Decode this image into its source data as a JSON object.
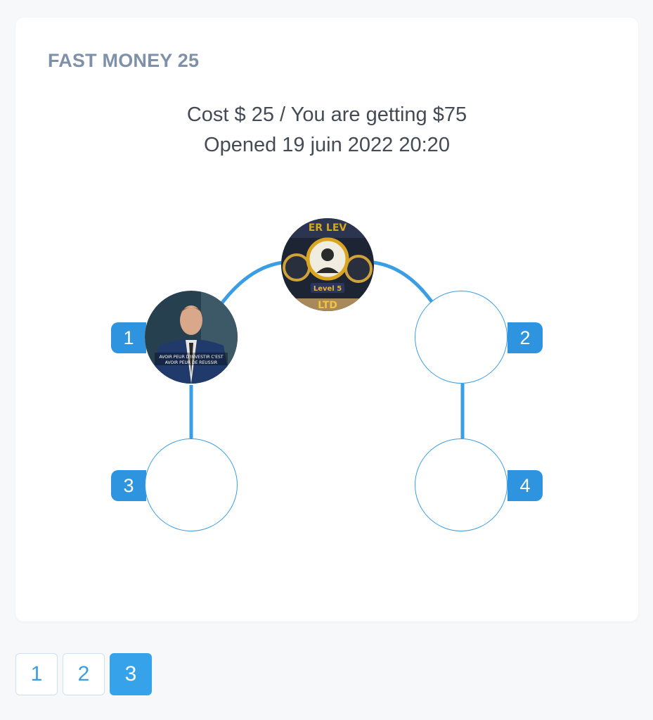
{
  "card": {
    "title": "FAST MONEY 25",
    "cost_line": "Cost $ 25 / You are getting $75",
    "opened_line": "Opened 19 juin 2022 20:20"
  },
  "tree": {
    "accent_color": "#2f94df",
    "root": {
      "filled": true,
      "image": "level-5-banner-avatar"
    },
    "slots": [
      {
        "number": "1",
        "filled": true,
        "image": "man-in-suit-avatar"
      },
      {
        "number": "2",
        "filled": false
      },
      {
        "number": "3",
        "filled": false
      },
      {
        "number": "4",
        "filled": false
      }
    ]
  },
  "pagination": {
    "pages": [
      "1",
      "2",
      "3"
    ],
    "active": "3"
  }
}
